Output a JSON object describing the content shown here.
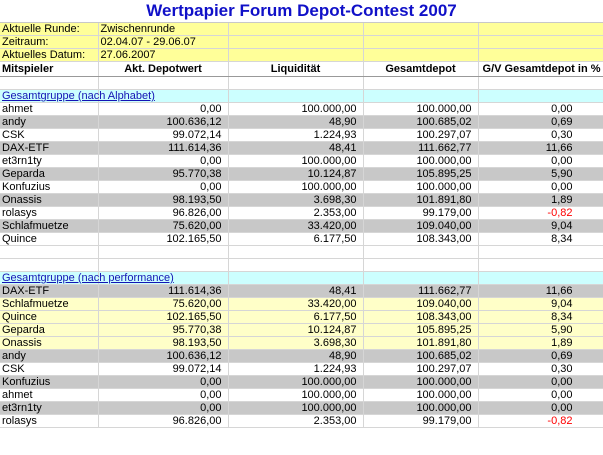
{
  "title": "Wertpapier Forum Depot-Contest 2007",
  "info": [
    {
      "label": "Aktuelle Runde:",
      "value": "Zwischenrunde"
    },
    {
      "label": "Zeitraum:",
      "value": "02.04.07 - 29.06.07"
    },
    {
      "label": "Aktuelles Datum:",
      "value": "27.06.2007"
    }
  ],
  "headers": [
    "Mitspieler",
    "Akt. Depotwert",
    "Liquidität",
    "Gesamtdepot",
    "G/V Gesamtdepot in %"
  ],
  "groups": [
    {
      "title": "Gesamtgruppe (nach Alphabet)",
      "rows": [
        {
          "name": "ahmet",
          "depot": "0,00",
          "liq": "100.000,00",
          "total": "100.000,00",
          "gv": "0,00",
          "style": "white"
        },
        {
          "name": "andy",
          "depot": "100.636,12",
          "liq": "48,90",
          "total": "100.685,02",
          "gv": "0,69",
          "style": "gray"
        },
        {
          "name": "CSK",
          "depot": "99.072,14",
          "liq": "1.224,93",
          "total": "100.297,07",
          "gv": "0,30",
          "style": "white"
        },
        {
          "name": "DAX-ETF",
          "depot": "111.614,36",
          "liq": "48,41",
          "total": "111.662,77",
          "gv": "11,66",
          "style": "gray"
        },
        {
          "name": "et3rn1ty",
          "depot": "0,00",
          "liq": "100.000,00",
          "total": "100.000,00",
          "gv": "0,00",
          "style": "white"
        },
        {
          "name": "Geparda",
          "depot": "95.770,38",
          "liq": "10.124,87",
          "total": "105.895,25",
          "gv": "5,90",
          "style": "gray"
        },
        {
          "name": "Konfuzius",
          "depot": "0,00",
          "liq": "100.000,00",
          "total": "100.000,00",
          "gv": "0,00",
          "style": "white"
        },
        {
          "name": "Onassis",
          "depot": "98.193,50",
          "liq": "3.698,30",
          "total": "101.891,80",
          "gv": "1,89",
          "style": "gray"
        },
        {
          "name": "rolasys",
          "depot": "96.826,00",
          "liq": "2.353,00",
          "total": "99.179,00",
          "gv": "-0,82",
          "style": "white",
          "neg": true
        },
        {
          "name": "Schlafmuetze",
          "depot": "75.620,00",
          "liq": "33.420,00",
          "total": "109.040,00",
          "gv": "9,04",
          "style": "gray"
        },
        {
          "name": "Quince",
          "depot": "102.165,50",
          "liq": "6.177,50",
          "total": "108.343,00",
          "gv": "8,34",
          "style": "white"
        }
      ]
    },
    {
      "title": "Gesamtgruppe (nach performance)",
      "rows": [
        {
          "name": "DAX-ETF",
          "depot": "111.614,36",
          "liq": "48,41",
          "total": "111.662,77",
          "gv": "11,66",
          "style": "gray"
        },
        {
          "name": "Schlafmuetze",
          "depot": "75.620,00",
          "liq": "33.420,00",
          "total": "109.040,00",
          "gv": "9,04",
          "style": "yellow"
        },
        {
          "name": "Quince",
          "depot": "102.165,50",
          "liq": "6.177,50",
          "total": "108.343,00",
          "gv": "8,34",
          "style": "yellow"
        },
        {
          "name": "Geparda",
          "depot": "95.770,38",
          "liq": "10.124,87",
          "total": "105.895,25",
          "gv": "5,90",
          "style": "yellow"
        },
        {
          "name": "Onassis",
          "depot": "98.193,50",
          "liq": "3.698,30",
          "total": "101.891,80",
          "gv": "1,89",
          "style": "yellow"
        },
        {
          "name": "andy",
          "depot": "100.636,12",
          "liq": "48,90",
          "total": "100.685,02",
          "gv": "0,69",
          "style": "gray"
        },
        {
          "name": "CSK",
          "depot": "99.072,14",
          "liq": "1.224,93",
          "total": "100.297,07",
          "gv": "0,30",
          "style": "white"
        },
        {
          "name": "Konfuzius",
          "depot": "0,00",
          "liq": "100.000,00",
          "total": "100.000,00",
          "gv": "0,00",
          "style": "gray"
        },
        {
          "name": "ahmet",
          "depot": "0,00",
          "liq": "100.000,00",
          "total": "100.000,00",
          "gv": "0,00",
          "style": "white"
        },
        {
          "name": "et3rn1ty",
          "depot": "0,00",
          "liq": "100.000,00",
          "total": "100.000,00",
          "gv": "0,00",
          "style": "gray"
        },
        {
          "name": "rolasys",
          "depot": "96.826,00",
          "liq": "2.353,00",
          "total": "99.179,00",
          "gv": "-0,82",
          "style": "white",
          "neg": true
        }
      ]
    }
  ]
}
